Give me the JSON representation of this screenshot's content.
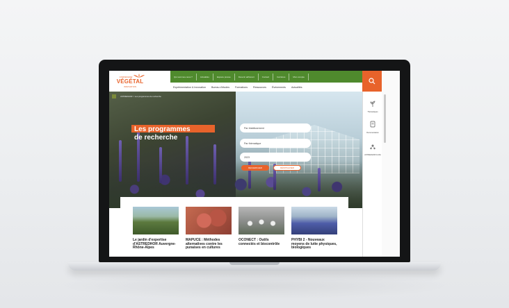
{
  "site": {
    "logo": {
      "small": "ASTREDHOR",
      "main": "VÉGÉTAL",
      "sub": "INNOVATION"
    },
    "topbar": [
      "Qui sommes-nous ?",
      "Actualités",
      "Espace presse",
      "Devenir adhérent",
      "Contact",
      "Carrières",
      "Mon compte"
    ],
    "mainnav": [
      "Expérimentation & Innovation",
      "Bureau d'études",
      "Formations",
      "Ressources",
      "Événements",
      "Actualités"
    ],
    "sidebar": [
      {
        "icon": "sprout-icon",
        "label": "Thématiques"
      },
      {
        "icon": "document-icon",
        "label": "Documentation"
      },
      {
        "icon": "network-icon",
        "label": "ASTREDHOR & Moi"
      }
    ],
    "breadcrumb": "ASTREDHOR > Les programmes de recherche",
    "hero": {
      "title_line1": "Les programmes",
      "title_line2": "de recherche"
    },
    "filters": [
      {
        "label": "Par établissement"
      },
      {
        "label": "Par thématique"
      },
      {
        "label": "2023"
      }
    ],
    "buttons": {
      "search": "RECHERCHER",
      "reset": "RÉINITIALISER"
    },
    "cards": [
      {
        "title": "Le jardin d'expertise d'ASTREDHOR Auvergne-Rhône-Alpes"
      },
      {
        "title": "MAPUCE : Méthodes alternatives contre les punaises en cultures"
      },
      {
        "title": "OCONECT : Outils connectés et biocontrôle"
      },
      {
        "title": "PHYBI 2 - Nouveaux moyens de lutte physiques, biologiques"
      }
    ]
  },
  "colors": {
    "accent": "#e8632b",
    "green": "#4f8a2d"
  }
}
